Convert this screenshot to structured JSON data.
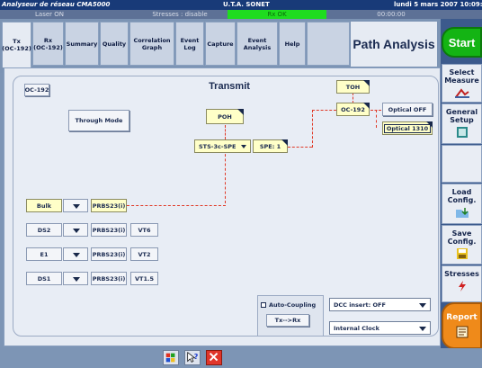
{
  "window": {
    "title": "Analyseur de réseau CMA5000",
    "center_title": "U.T.A. SONET",
    "datetime": "lundi 5 mars 2007 10:09:"
  },
  "status": {
    "laser": "Laser ON",
    "stresses": "Stresses : disable",
    "rx": "Rx OK",
    "timer": "00:00:00"
  },
  "tabs": [
    {
      "label": "Tx\n(OC-192)",
      "active": true
    },
    {
      "label": "Rx\n(OC-192)"
    },
    {
      "label": "Summary"
    },
    {
      "label": "Quality"
    },
    {
      "label": "Correlation\nGraph"
    },
    {
      "label": "Event\nLog"
    },
    {
      "label": "Capture"
    },
    {
      "label": "Event\nAnalysis"
    },
    {
      "label": "Help"
    }
  ],
  "page_title": "Path Analysis",
  "main": {
    "title": "Transmit",
    "oc_label": "OC-192",
    "through_mode": "Through Mode",
    "poh": "POH",
    "toh": "TOH",
    "oc192_box": "OC-192",
    "optical_off": "Optical OFF",
    "optical_1310": "Optical 1310",
    "sts_select": "STS-3c-SPE",
    "spe": "SPE: 1",
    "payload_rows": [
      {
        "type": "Bulk",
        "pattern": "PRBS23(i)",
        "extra": ""
      },
      {
        "type": "DS2",
        "pattern": "PRBS23(i)",
        "extra": "VT6"
      },
      {
        "type": "E1",
        "pattern": "PRBS23(i)",
        "extra": "VT2"
      },
      {
        "type": "DS1",
        "pattern": "PRBS23(i)",
        "extra": "VT1.5"
      }
    ],
    "auto_coupling": "Auto-Coupling",
    "tx_rx": "Tx-->Rx",
    "dcc_insert": "DCC insert: OFF",
    "clock": "Internal Clock"
  },
  "right_panel": {
    "start": "Start",
    "select_measure": "Select\nMeasure",
    "general_setup": "General\nSetup",
    "load_config": "Load\nConfig.",
    "save_config": "Save\nConfig.",
    "stresses": "Stresses",
    "report": "Report"
  },
  "colors": {
    "title_bar": "#183a78",
    "rx_ok": "#1fdc1f",
    "start": "#14b414",
    "report": "#ef8a1a",
    "link_line": "#e03a28",
    "yellow_box": "#ffffc8"
  }
}
